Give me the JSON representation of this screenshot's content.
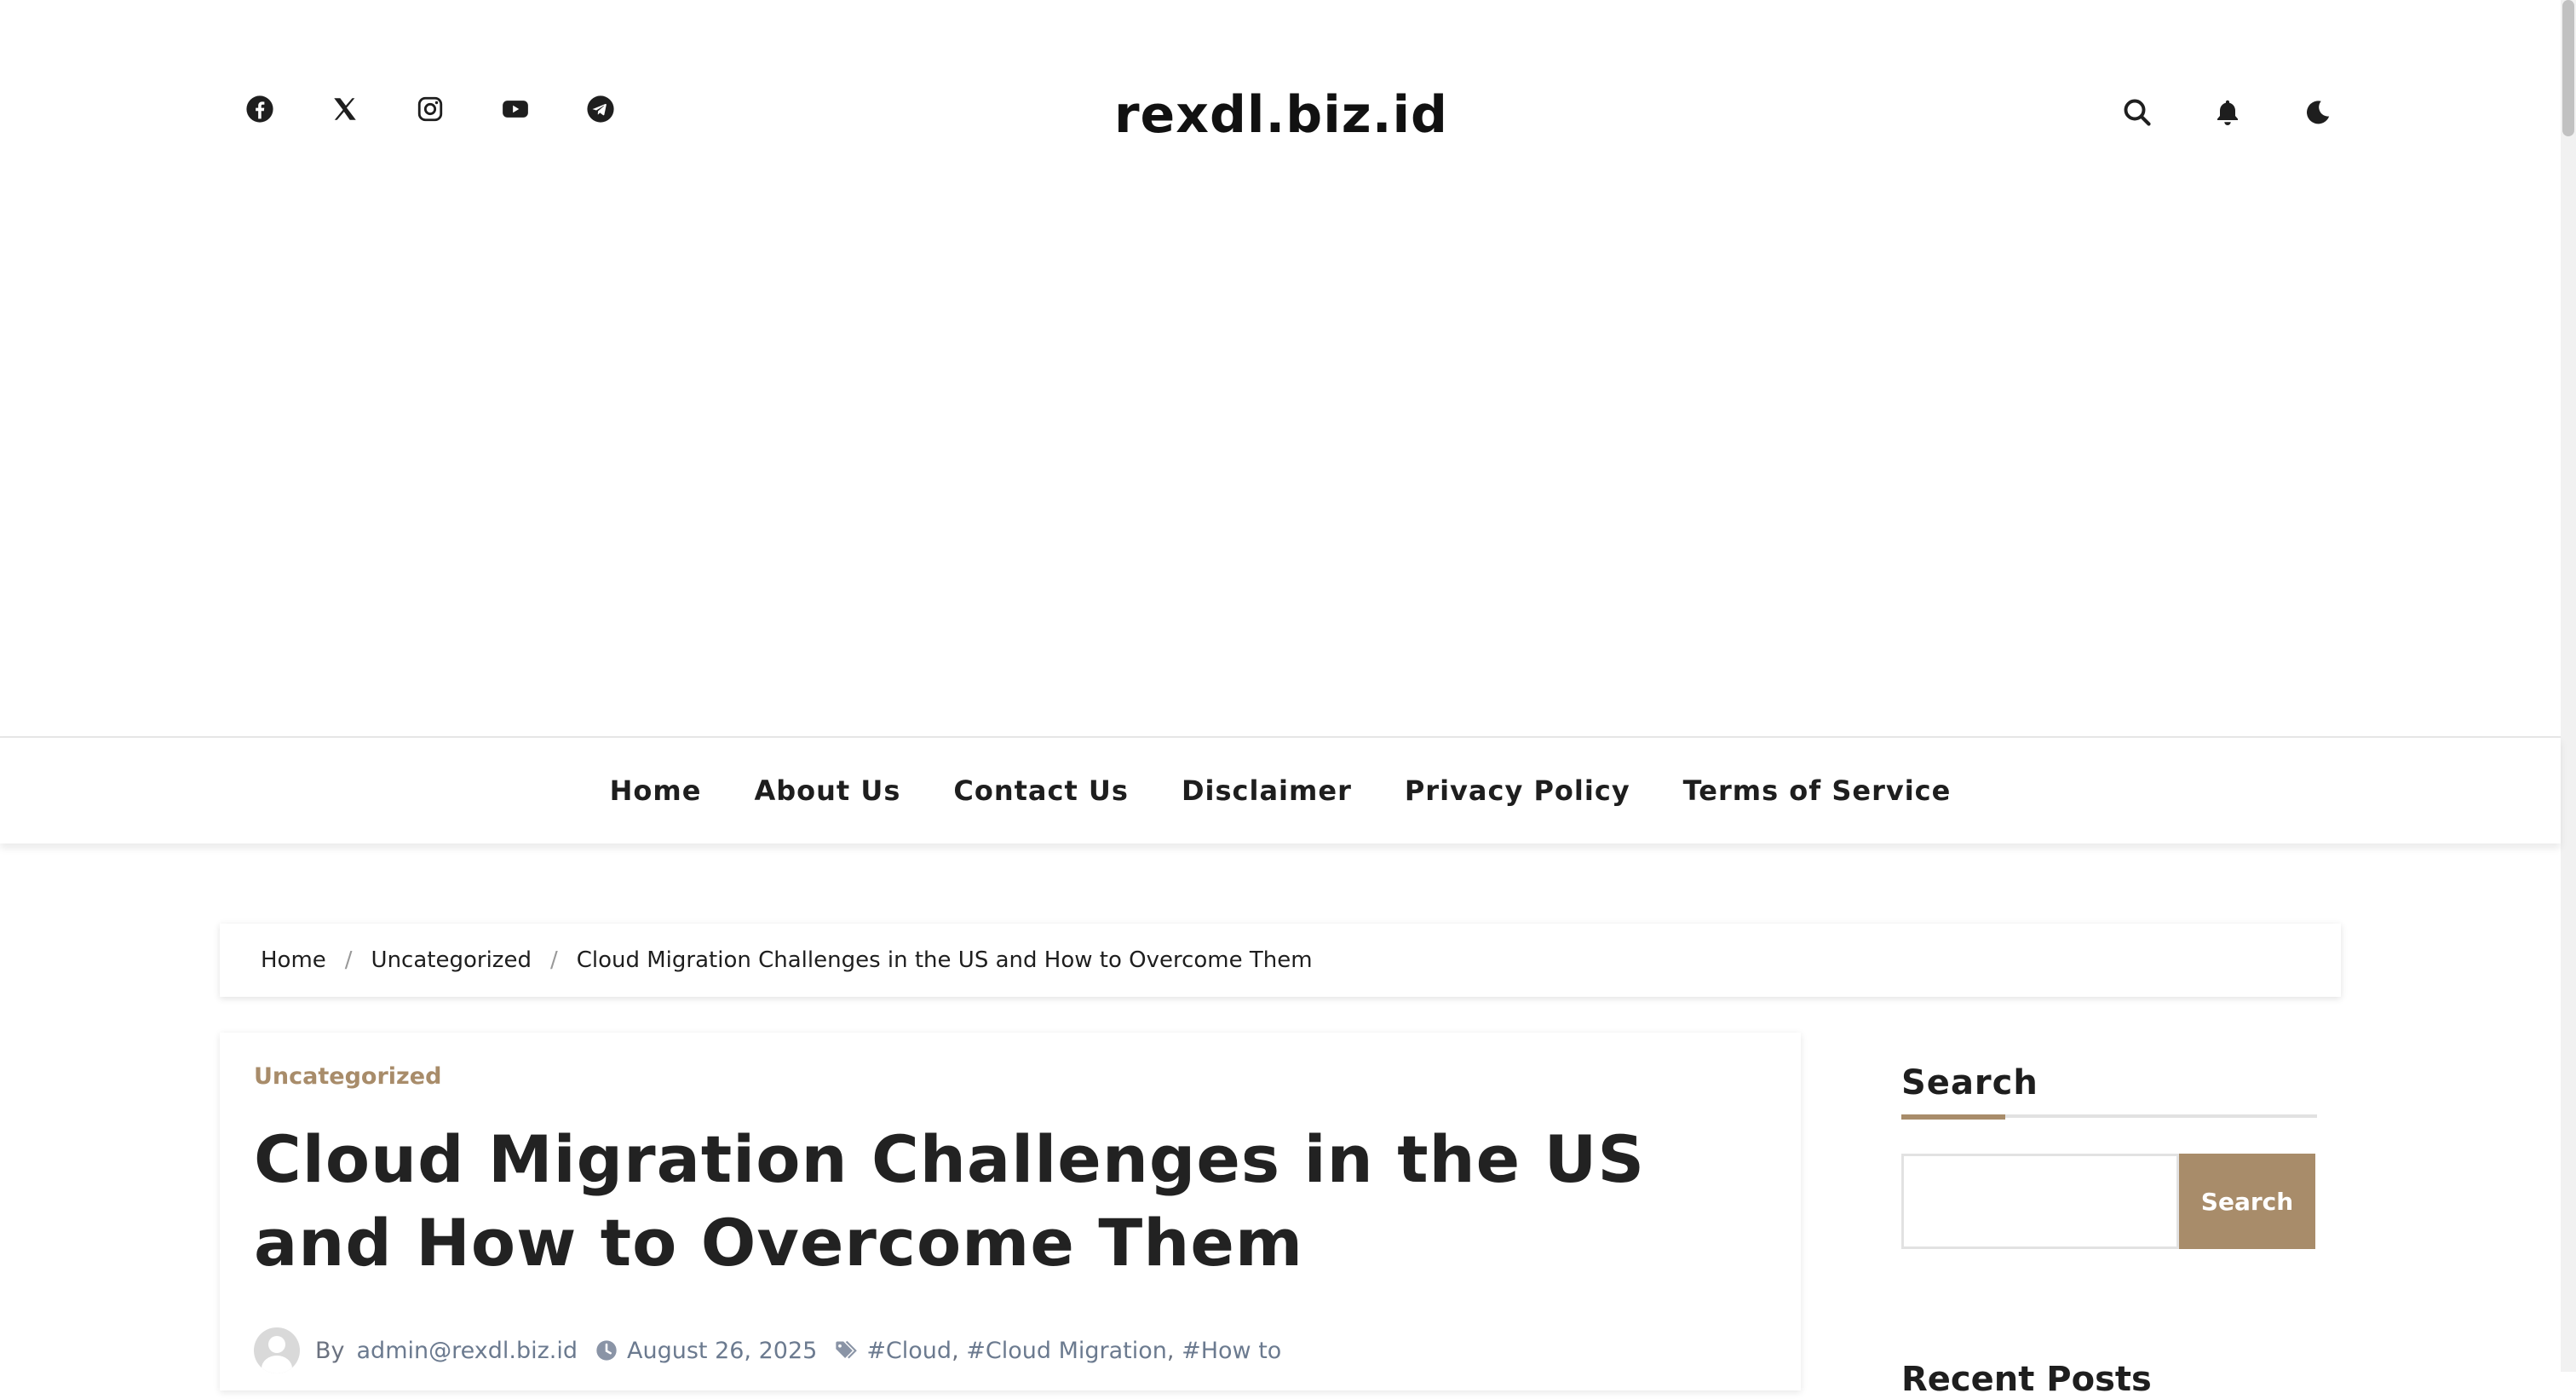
{
  "header": {
    "site_title": "rexdl.biz.id",
    "social_icons": [
      "facebook-icon",
      "x-twitter-icon",
      "instagram-icon",
      "youtube-icon",
      "telegram-icon"
    ],
    "action_icons": [
      "search-icon",
      "bell-icon",
      "moon-icon"
    ]
  },
  "nav": {
    "items": [
      "Home",
      "About Us",
      "Contact Us",
      "Disclaimer",
      "Privacy Policy",
      "Terms of Service"
    ]
  },
  "breadcrumb": {
    "items": [
      "Home",
      "Uncategorized",
      "Cloud Migration Challenges in the US and How to Overcome Them"
    ],
    "separator": "/"
  },
  "article": {
    "category": "Uncategorized",
    "title": "Cloud Migration Challenges in the US and How to Overcome Them",
    "by_label": "By",
    "author": "admin@rexdl.biz.id",
    "date": "August 26, 2025",
    "tags": [
      "#Cloud",
      "#Cloud Migration",
      "#How to"
    ],
    "tag_separator": ","
  },
  "sidebar": {
    "search_title": "Search",
    "search_placeholder": "",
    "search_button": "Search",
    "next_widget_title": "Recent Posts"
  },
  "colors": {
    "accent": "#a88c6a",
    "text": "#1e1e1e",
    "meta": "#6b7a8f"
  }
}
